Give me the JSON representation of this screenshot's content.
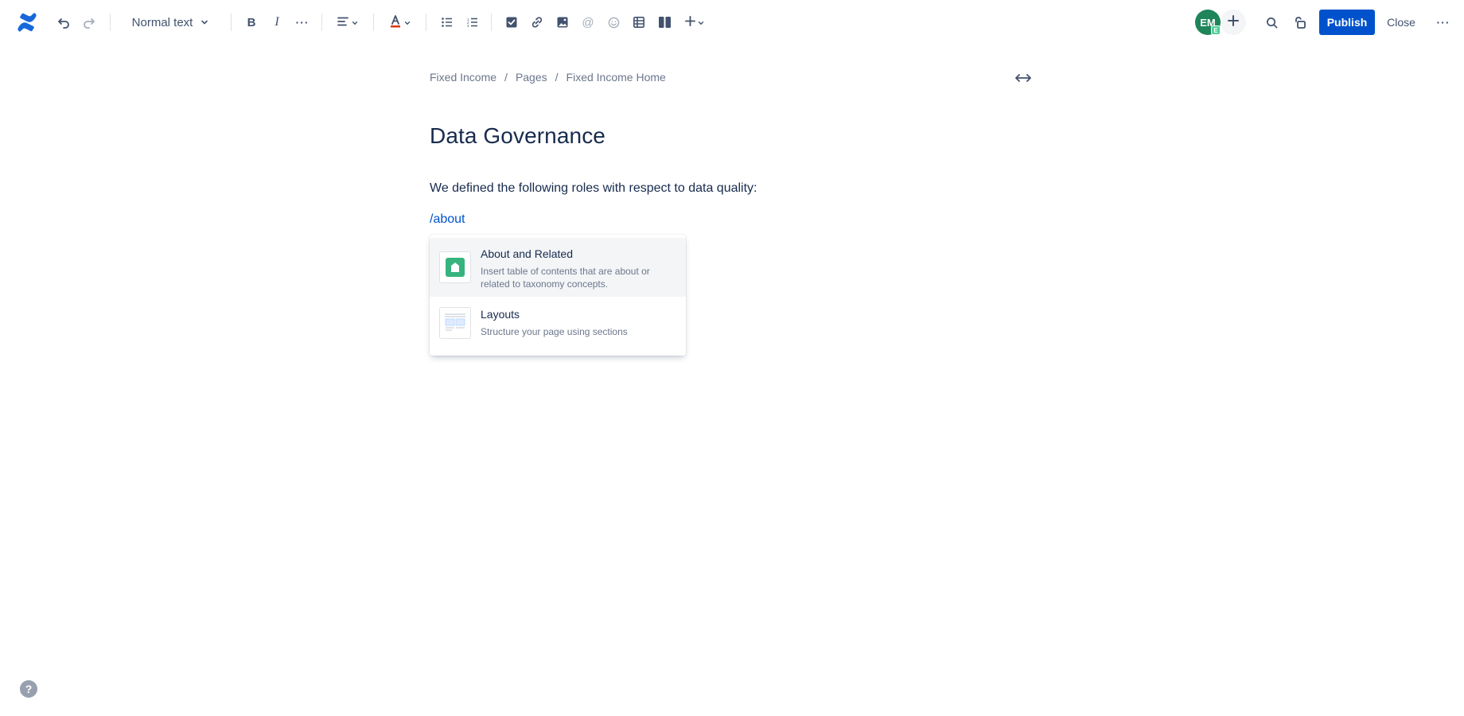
{
  "colors": {
    "brand": "#0052cc",
    "avatar": "#1f845a",
    "text": "#172b4d",
    "subtle": "#6b778c"
  },
  "toolbar": {
    "text_style": "Normal text",
    "icons": [
      "confluence-logo-icon",
      "undo-icon",
      "redo-icon",
      "bold-icon",
      "italic-icon",
      "more-formatting-icon",
      "align-icon",
      "text-color-icon",
      "bullet-list-icon",
      "numbered-list-icon",
      "task-icon",
      "link-icon",
      "image-icon",
      "mention-icon",
      "emoji-icon",
      "table-icon",
      "layout-icon",
      "insert-icon",
      "search-icon",
      "restrictions-icon",
      "more-icon"
    ],
    "avatar_initials": "EM",
    "avatar_badge": "E",
    "publish_label": "Publish",
    "close_label": "Close"
  },
  "breadcrumb": [
    "Fixed Income",
    "Pages",
    "Fixed Income Home"
  ],
  "page": {
    "title": "Data Governance",
    "paragraph": "We defined the following roles with respect to data quality:",
    "slash_command": "/about"
  },
  "menu": {
    "items": [
      {
        "title": "About and Related",
        "description": "Insert table of contents that are about or related to taxonomy concepts.",
        "selected": true
      },
      {
        "title": "Layouts",
        "description": "Structure your page using sections",
        "selected": false
      }
    ]
  },
  "help_label": "?"
}
